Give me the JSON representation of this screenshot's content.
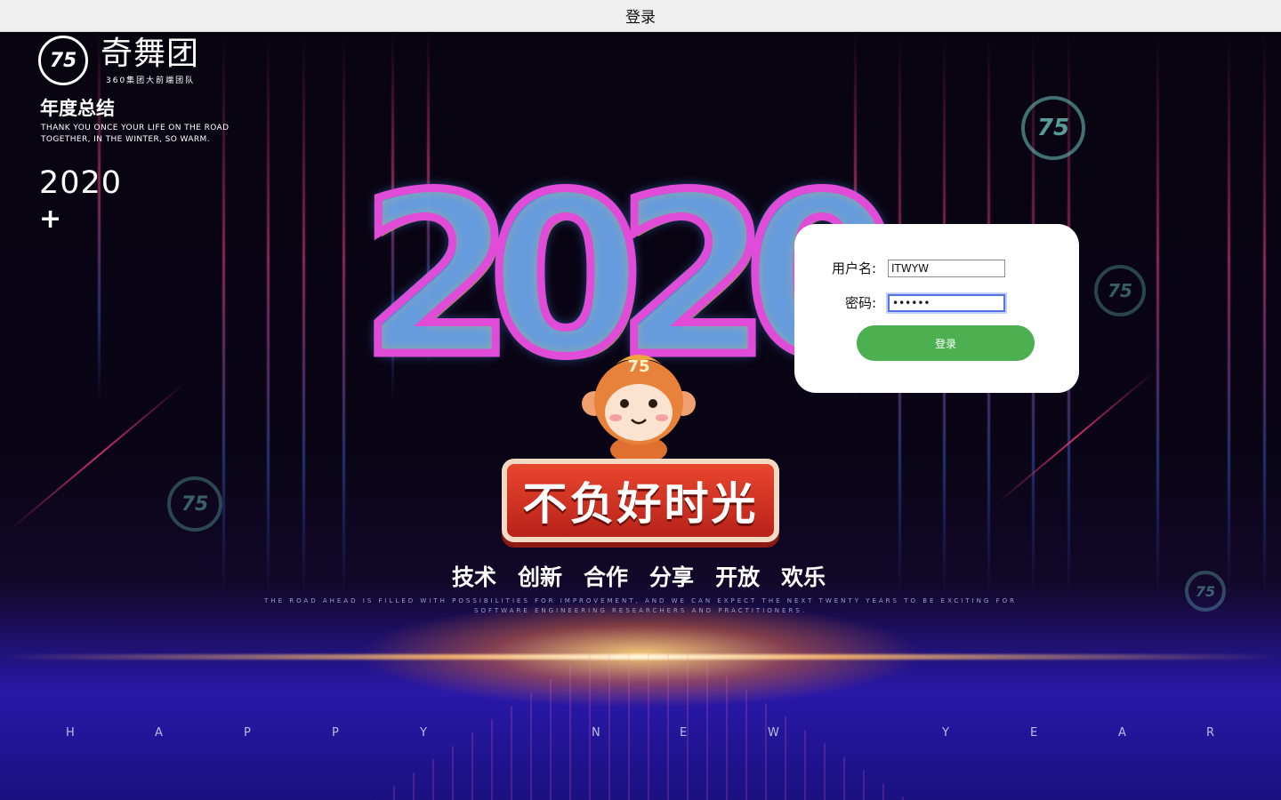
{
  "window": {
    "title": "登录"
  },
  "brand": {
    "logo_mark": "75",
    "name": "奇舞团",
    "subtitle": "360集团大前端团队",
    "heading": "年度总结",
    "tagline": "THANK YOU ONCE YOUR LIFE ON THE ROAD TOGETHER, IN THE WINTER, SO WARM.",
    "year": "2020",
    "plus": "+"
  },
  "hero": {
    "big_year": "2020",
    "slogan": "不负好时光",
    "keywords": [
      "技术",
      "创新",
      "合作",
      "分享",
      "开放",
      "欢乐"
    ],
    "motto": "THE ROAD AHEAD IS FILLED WITH POSSIBILITIES FOR IMPROVEMENT, AND WE CAN EXPECT THE NEXT TWENTY YEARS TO BE EXCITING FOR SOFTWARE ENGINEERING RESEARCHERS AND PRACTITIONERS.",
    "happy_new_year_letters": [
      "H",
      "A",
      "P",
      "P",
      "Y",
      "N",
      "E",
      "W",
      "Y",
      "E",
      "A",
      "R"
    ]
  },
  "login": {
    "username_label": "用户名:",
    "username_value": "ITWYW",
    "password_label": "密码:",
    "password_value": "••••••",
    "submit_label": "登录"
  },
  "colors": {
    "button": "#4caf50",
    "focus_ring": "#4f73e8",
    "banner": "#d33a24"
  }
}
